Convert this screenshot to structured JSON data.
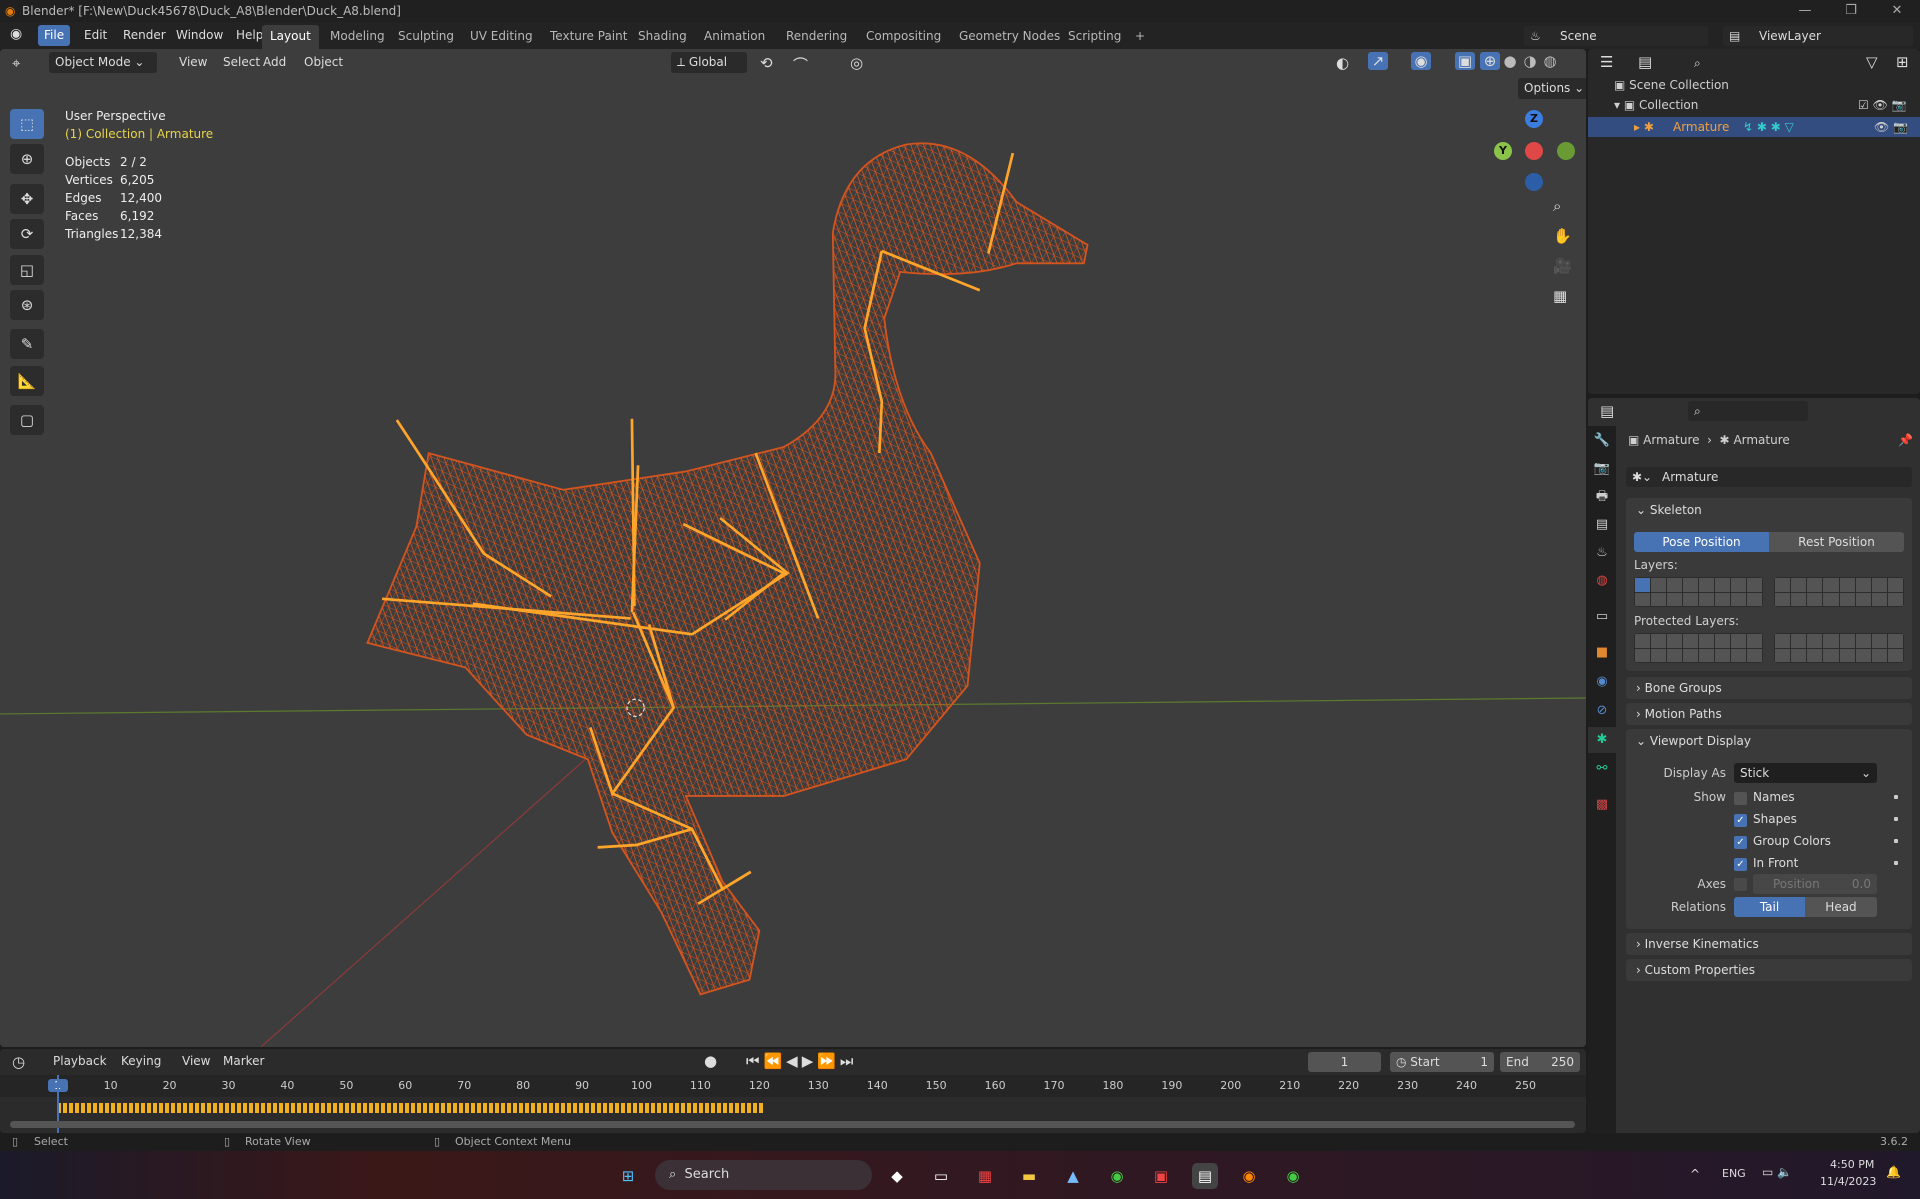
{
  "window": {
    "title": "Blender* [F:\\New\\Duck45678\\Duck_A8\\Blender\\Duck_A8.blend]",
    "minimize": "—",
    "restore": "❐",
    "close": "✕"
  },
  "menu": {
    "items": [
      "File",
      "Edit",
      "Render",
      "Window",
      "Help"
    ],
    "workspaces": [
      "Layout",
      "Modeling",
      "Sculpting",
      "UV Editing",
      "Texture Paint",
      "Shading",
      "Animation",
      "Rendering",
      "Compositing",
      "Geometry Nodes",
      "Scripting",
      "+"
    ],
    "scene": "Scene",
    "view_layer": "ViewLayer"
  },
  "viewport": {
    "mode": "Object Mode",
    "menus": [
      "View",
      "Select",
      "Add",
      "Object"
    ],
    "orientation": "Global",
    "options": "Options",
    "overlay_title": "User Perspective",
    "overlay_sub": "(1) Collection | Armature",
    "stats": [
      {
        "k": "Objects",
        "v": "2 / 2"
      },
      {
        "k": "Vertices",
        "v": "6,205"
      },
      {
        "k": "Edges",
        "v": "12,400"
      },
      {
        "k": "Faces",
        "v": "6,192"
      },
      {
        "k": "Triangles",
        "v": "12,384"
      }
    ],
    "gizmo": {
      "z": "Z",
      "y": "Y"
    }
  },
  "outliner": {
    "root": "Scene Collection",
    "collection": "Collection",
    "object": "Armature"
  },
  "properties": {
    "breadcrumb": [
      "Armature",
      "Armature"
    ],
    "data_name": "Armature",
    "skeleton": {
      "title": "Skeleton",
      "pose": "Pose Position",
      "rest": "Rest Position",
      "layers": "Layers:",
      "protected": "Protected Layers:"
    },
    "collapsed_top": [
      "Bone Groups",
      "Motion Paths"
    ],
    "viewport_display": {
      "title": "Viewport Display",
      "display_as_label": "Display As",
      "display_as": "Stick",
      "show_label": "Show",
      "show": [
        {
          "label": "Names",
          "checked": false
        },
        {
          "label": "Shapes",
          "checked": true
        },
        {
          "label": "Group Colors",
          "checked": true
        },
        {
          "label": "In Front",
          "checked": true
        }
      ],
      "axes_label": "Axes",
      "axes_position": "Position",
      "axes_value": "0.0",
      "relations_label": "Relations",
      "tail": "Tail",
      "head": "Head"
    },
    "collapsed_bottom": [
      "Inverse Kinematics",
      "Custom Properties"
    ]
  },
  "timeline": {
    "menus": [
      "Playback",
      "Keying",
      "View",
      "Marker"
    ],
    "current_frame": "1",
    "start_label": "Start",
    "start": "1",
    "end_label": "End",
    "end": "250",
    "ruler": [
      "1",
      "10",
      "20",
      "30",
      "40",
      "50",
      "60",
      "70",
      "80",
      "90",
      "100",
      "110",
      "120",
      "130",
      "140",
      "150",
      "160",
      "170",
      "180",
      "190",
      "200",
      "210",
      "220",
      "230",
      "240",
      "250"
    ],
    "keyframe_end": 121
  },
  "status": {
    "select": "Select",
    "rotate": "Rotate View",
    "context": "Object Context Menu",
    "version": "3.6.2"
  },
  "taskbar": {
    "search": "Search",
    "lang": "ENG",
    "time": "4:50 PM",
    "date": "11/4/2023"
  },
  "colors": {
    "accent": "#4772b3",
    "mesh": "#d2541f",
    "bone": "#ffa52a"
  }
}
